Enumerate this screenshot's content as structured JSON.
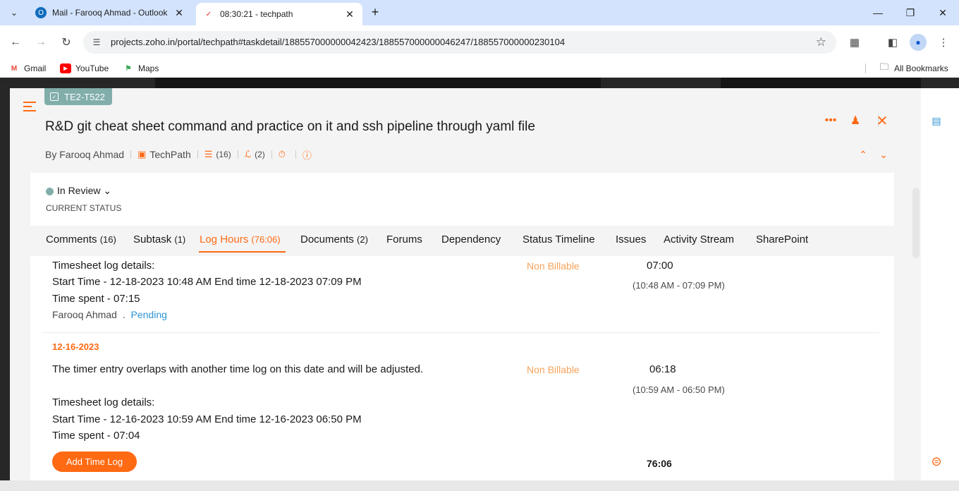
{
  "browser": {
    "tabs": [
      {
        "title": "Mail - Farooq Ahmad - Outlook",
        "active": false
      },
      {
        "title": "08:30:21 - techpath",
        "active": true
      }
    ],
    "new_tab": "+",
    "url": "projects.zoho.in/portal/techpath#taskdetail/188557000000042423/188557000000046247/188557000000230104",
    "bookmarks": [
      {
        "label": "Gmail",
        "icon": "gmail-icon"
      },
      {
        "label": "YouTube",
        "icon": "youtube-icon"
      },
      {
        "label": "Maps",
        "icon": "maps-icon"
      }
    ],
    "all_bookmarks": "All Bookmarks"
  },
  "task": {
    "id": "TE2-T522",
    "title": "R&D git cheat sheet command and practice on it and ssh pipeline through yaml file",
    "author": "By Farooq Ahmad",
    "project": "TechPath",
    "comments_count": "(16)",
    "attachments_count": "(2)",
    "status": "In Review",
    "status_caption": "CURRENT STATUS"
  },
  "tabs": {
    "comments": {
      "label": "Comments",
      "count": "(16)"
    },
    "subtask": {
      "label": "Subtask",
      "count": "(1)"
    },
    "log_hours": {
      "label": "Log Hours",
      "count": "(76:06)"
    },
    "documents": {
      "label": "Documents",
      "count": "(2)"
    },
    "forums": "Forums",
    "dependency": "Dependency",
    "status_timeline": "Status Timeline",
    "issues": "Issues",
    "activity_stream": "Activity Stream",
    "sharepoint": "SharePoint"
  },
  "logs": [
    {
      "details_label": "Timesheet log details:",
      "start_end": "Start Time - 12-18-2023 10:48 AM End time 12-18-2023 07:09 PM",
      "time_spent": "Time spent - 07:15",
      "user": "Farooq Ahmad",
      "dot": ".",
      "approval": "Pending",
      "billing": "Non Billable",
      "hours": "07:00",
      "range": "(10:48 AM - 07:09 PM)"
    },
    {
      "date": "12-16-2023",
      "overlap_note": "The timer entry overlaps with another time log on this date and will be adjusted.",
      "details_label": "Timesheet log details:",
      "start_end": "Start Time - 12-16-2023 10:59 AM End time 12-16-2023 06:50 PM",
      "time_spent": "Time spent - 07:04",
      "billing": "Non Billable",
      "hours": "06:18",
      "range": "(10:59 AM - 06:50 PM)"
    }
  ],
  "footer": {
    "add_time_log": "Add Time Log",
    "total": "76:06"
  },
  "colors": {
    "accent": "#ff6a13",
    "status": "#82aeaa",
    "link": "#2e94d4",
    "billable": "#f5a35b"
  }
}
